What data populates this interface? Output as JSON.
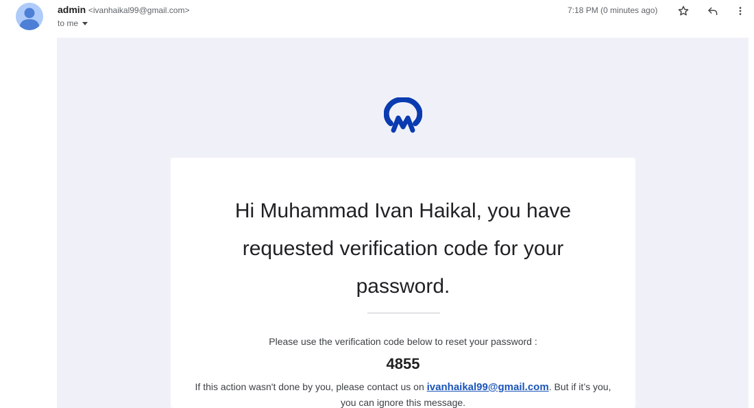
{
  "header": {
    "sender_name": "admin",
    "sender_email": "<ivanhaikal99@gmail.com>",
    "recipient_label": "to me",
    "timestamp": "7:18 PM (0 minutes ago)"
  },
  "icons": {
    "avatar": "person-avatar-icon",
    "star": "star-outline-icon",
    "reply": "reply-arrow-icon",
    "more": "more-vert-icon",
    "logo": "brand-logo-icon"
  },
  "email": {
    "title": "Hi Muhammad Ivan Haikal, you have requested verification code for your password.",
    "instruction": "Please use the verification code below to reset your password :",
    "code": "4855",
    "notice_before": "If this action wasn't done by you, please contact us on ",
    "notice_link": "ivanhaikal99@gmail.com",
    "notice_after": ". But if it’s you, you can ignore this message."
  },
  "colors": {
    "avatar_bg": "#aecbfa",
    "avatar_fg": "#4d7fd6",
    "email_background": "#f0f1f8",
    "logo_blue": "#0a3bb0",
    "link": "#1a54b8"
  }
}
